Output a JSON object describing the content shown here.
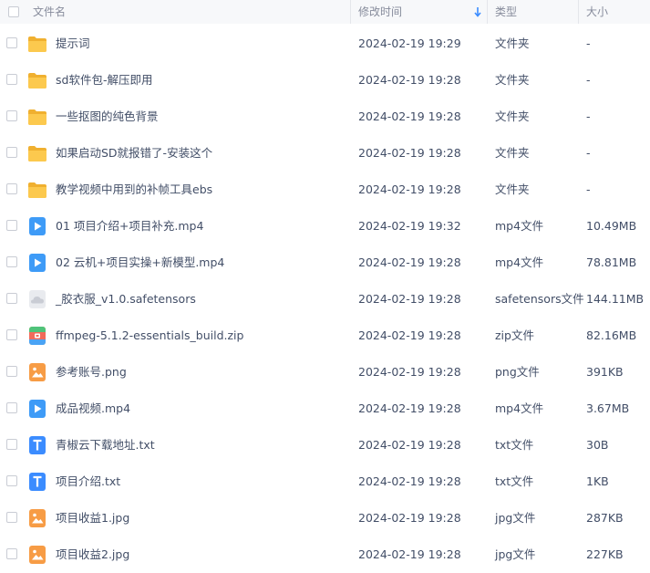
{
  "header": {
    "name_label": "文件名",
    "time_label": "修改时间",
    "type_label": "类型",
    "size_label": "大小",
    "sort_icon": "arrow-down-icon",
    "sort_color": "#3b8cff"
  },
  "files": [
    {
      "icon": "folder",
      "name": "提示词",
      "time": "2024-02-19 19:29",
      "type": "文件夹",
      "size": "-"
    },
    {
      "icon": "folder",
      "name": "sd软件包-解压即用",
      "time": "2024-02-19 19:28",
      "type": "文件夹",
      "size": "-"
    },
    {
      "icon": "folder",
      "name": "一些抠图的纯色背景",
      "time": "2024-02-19 19:28",
      "type": "文件夹",
      "size": "-"
    },
    {
      "icon": "folder",
      "name": "如果启动SD就报错了-安装这个",
      "time": "2024-02-19 19:28",
      "type": "文件夹",
      "size": "-"
    },
    {
      "icon": "folder",
      "name": "教学视频中用到的补帧工具ebs",
      "time": "2024-02-19 19:28",
      "type": "文件夹",
      "size": "-"
    },
    {
      "icon": "video",
      "name": "01 项目介绍+项目补充.mp4",
      "time": "2024-02-19 19:32",
      "type": "mp4文件",
      "size": "10.49MB"
    },
    {
      "icon": "video",
      "name": "02 云机+项目实操+新模型.mp4",
      "time": "2024-02-19 19:28",
      "type": "mp4文件",
      "size": "78.81MB"
    },
    {
      "icon": "unknown",
      "name": "_胶衣服_v1.0.safetensors",
      "time": "2024-02-19 19:28",
      "type": "safetensors文件",
      "size": "144.11MB"
    },
    {
      "icon": "zip",
      "name": "ffmpeg-5.1.2-essentials_build.zip",
      "time": "2024-02-19 19:28",
      "type": "zip文件",
      "size": "82.16MB"
    },
    {
      "icon": "image",
      "name": "参考账号.png",
      "time": "2024-02-19 19:28",
      "type": "png文件",
      "size": "391KB"
    },
    {
      "icon": "video",
      "name": "成品视频.mp4",
      "time": "2024-02-19 19:28",
      "type": "mp4文件",
      "size": "3.67MB"
    },
    {
      "icon": "text",
      "name": "青椒云下载地址.txt",
      "time": "2024-02-19 19:28",
      "type": "txt文件",
      "size": "30B"
    },
    {
      "icon": "text",
      "name": "项目介绍.txt",
      "time": "2024-02-19 19:28",
      "type": "txt文件",
      "size": "1KB"
    },
    {
      "icon": "image",
      "name": "项目收益1.jpg",
      "time": "2024-02-19 19:28",
      "type": "jpg文件",
      "size": "287KB"
    },
    {
      "icon": "image",
      "name": "项目收益2.jpg",
      "time": "2024-02-19 19:28",
      "type": "jpg文件",
      "size": "227KB"
    }
  ],
  "colors": {
    "folder": "#f7c043",
    "video": "#3e9bf7",
    "text": "#3b8cff",
    "image": "#f79c45",
    "unknown": "#c9ccd4"
  }
}
